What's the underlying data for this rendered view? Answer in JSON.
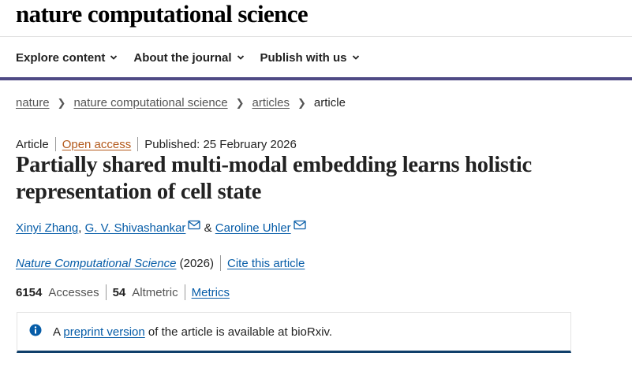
{
  "site": {
    "logo_text": "nature computational science"
  },
  "nav": {
    "items": [
      {
        "label": "Explore content"
      },
      {
        "label": "About the journal"
      },
      {
        "label": "Publish with us"
      }
    ]
  },
  "breadcrumbs": {
    "items": [
      "nature",
      "nature computational science",
      "articles"
    ],
    "current": "article"
  },
  "article": {
    "type": "Article",
    "access": "Open access",
    "published": "Published: 25 February 2026",
    "title": "Partially shared multi-modal embedding learns holistic representation of cell state",
    "authors": [
      "Xinyi Zhang",
      "G. V. Shivashankar",
      "Caroline Uhler"
    ],
    "author_sep_comma": ",",
    "author_sep_and": "&",
    "journal": "Nature Computational Science",
    "year": "(2026)",
    "cite_label": "Cite this article"
  },
  "metrics": {
    "accesses_value": "6154",
    "accesses_label": "Accesses",
    "altmetric_value": "54",
    "altmetric_label": "Altmetric",
    "metrics_link": "Metrics"
  },
  "notice": {
    "prefix": "A",
    "link": "preprint version",
    "suffix": "of the article is available at bioRxiv."
  },
  "colors": {
    "accent_bar": "#4f4a85",
    "link": "#075da8",
    "open_access": "#b3591b",
    "notice_border": "#0f3f6a"
  },
  "icons": {
    "chevron": "chevron-down-icon",
    "mail": "mail-icon",
    "info": "info-icon"
  }
}
